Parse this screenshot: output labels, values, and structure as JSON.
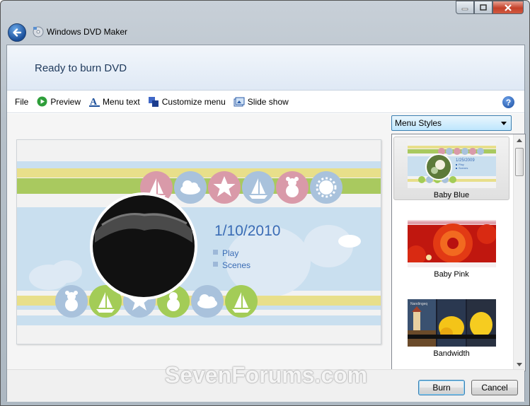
{
  "window": {
    "title": "Windows DVD Maker",
    "header": "Ready to burn DVD"
  },
  "toolbar": {
    "file": "File",
    "preview": "Preview",
    "menu_text": "Menu text",
    "customize_menu": "Customize menu",
    "slide_show": "Slide show",
    "help": "?"
  },
  "preview": {
    "date": "1/10/2010",
    "menu_items": [
      "Play",
      "Scenes"
    ]
  },
  "menu_styles": {
    "selected": "Menu Styles",
    "items": [
      {
        "label": "Baby Blue",
        "selected": true,
        "thumb_date": "1/25/2009",
        "thumb_items": [
          "Play",
          "Scenes"
        ]
      },
      {
        "label": "Baby Pink",
        "selected": false
      },
      {
        "label": "Bandwidth",
        "selected": false,
        "thumb_title": "Nandingeq"
      }
    ]
  },
  "buttons": {
    "burn": "Burn",
    "cancel": "Cancel"
  },
  "watermark": "SevenForums.com",
  "colors": {
    "accent": "#1e395b",
    "date_text": "#3a6cb5",
    "stripe_green": "#a9c95f",
    "stripe_yellow": "#e8df8a",
    "stripe_blue": "#c9dfef"
  }
}
